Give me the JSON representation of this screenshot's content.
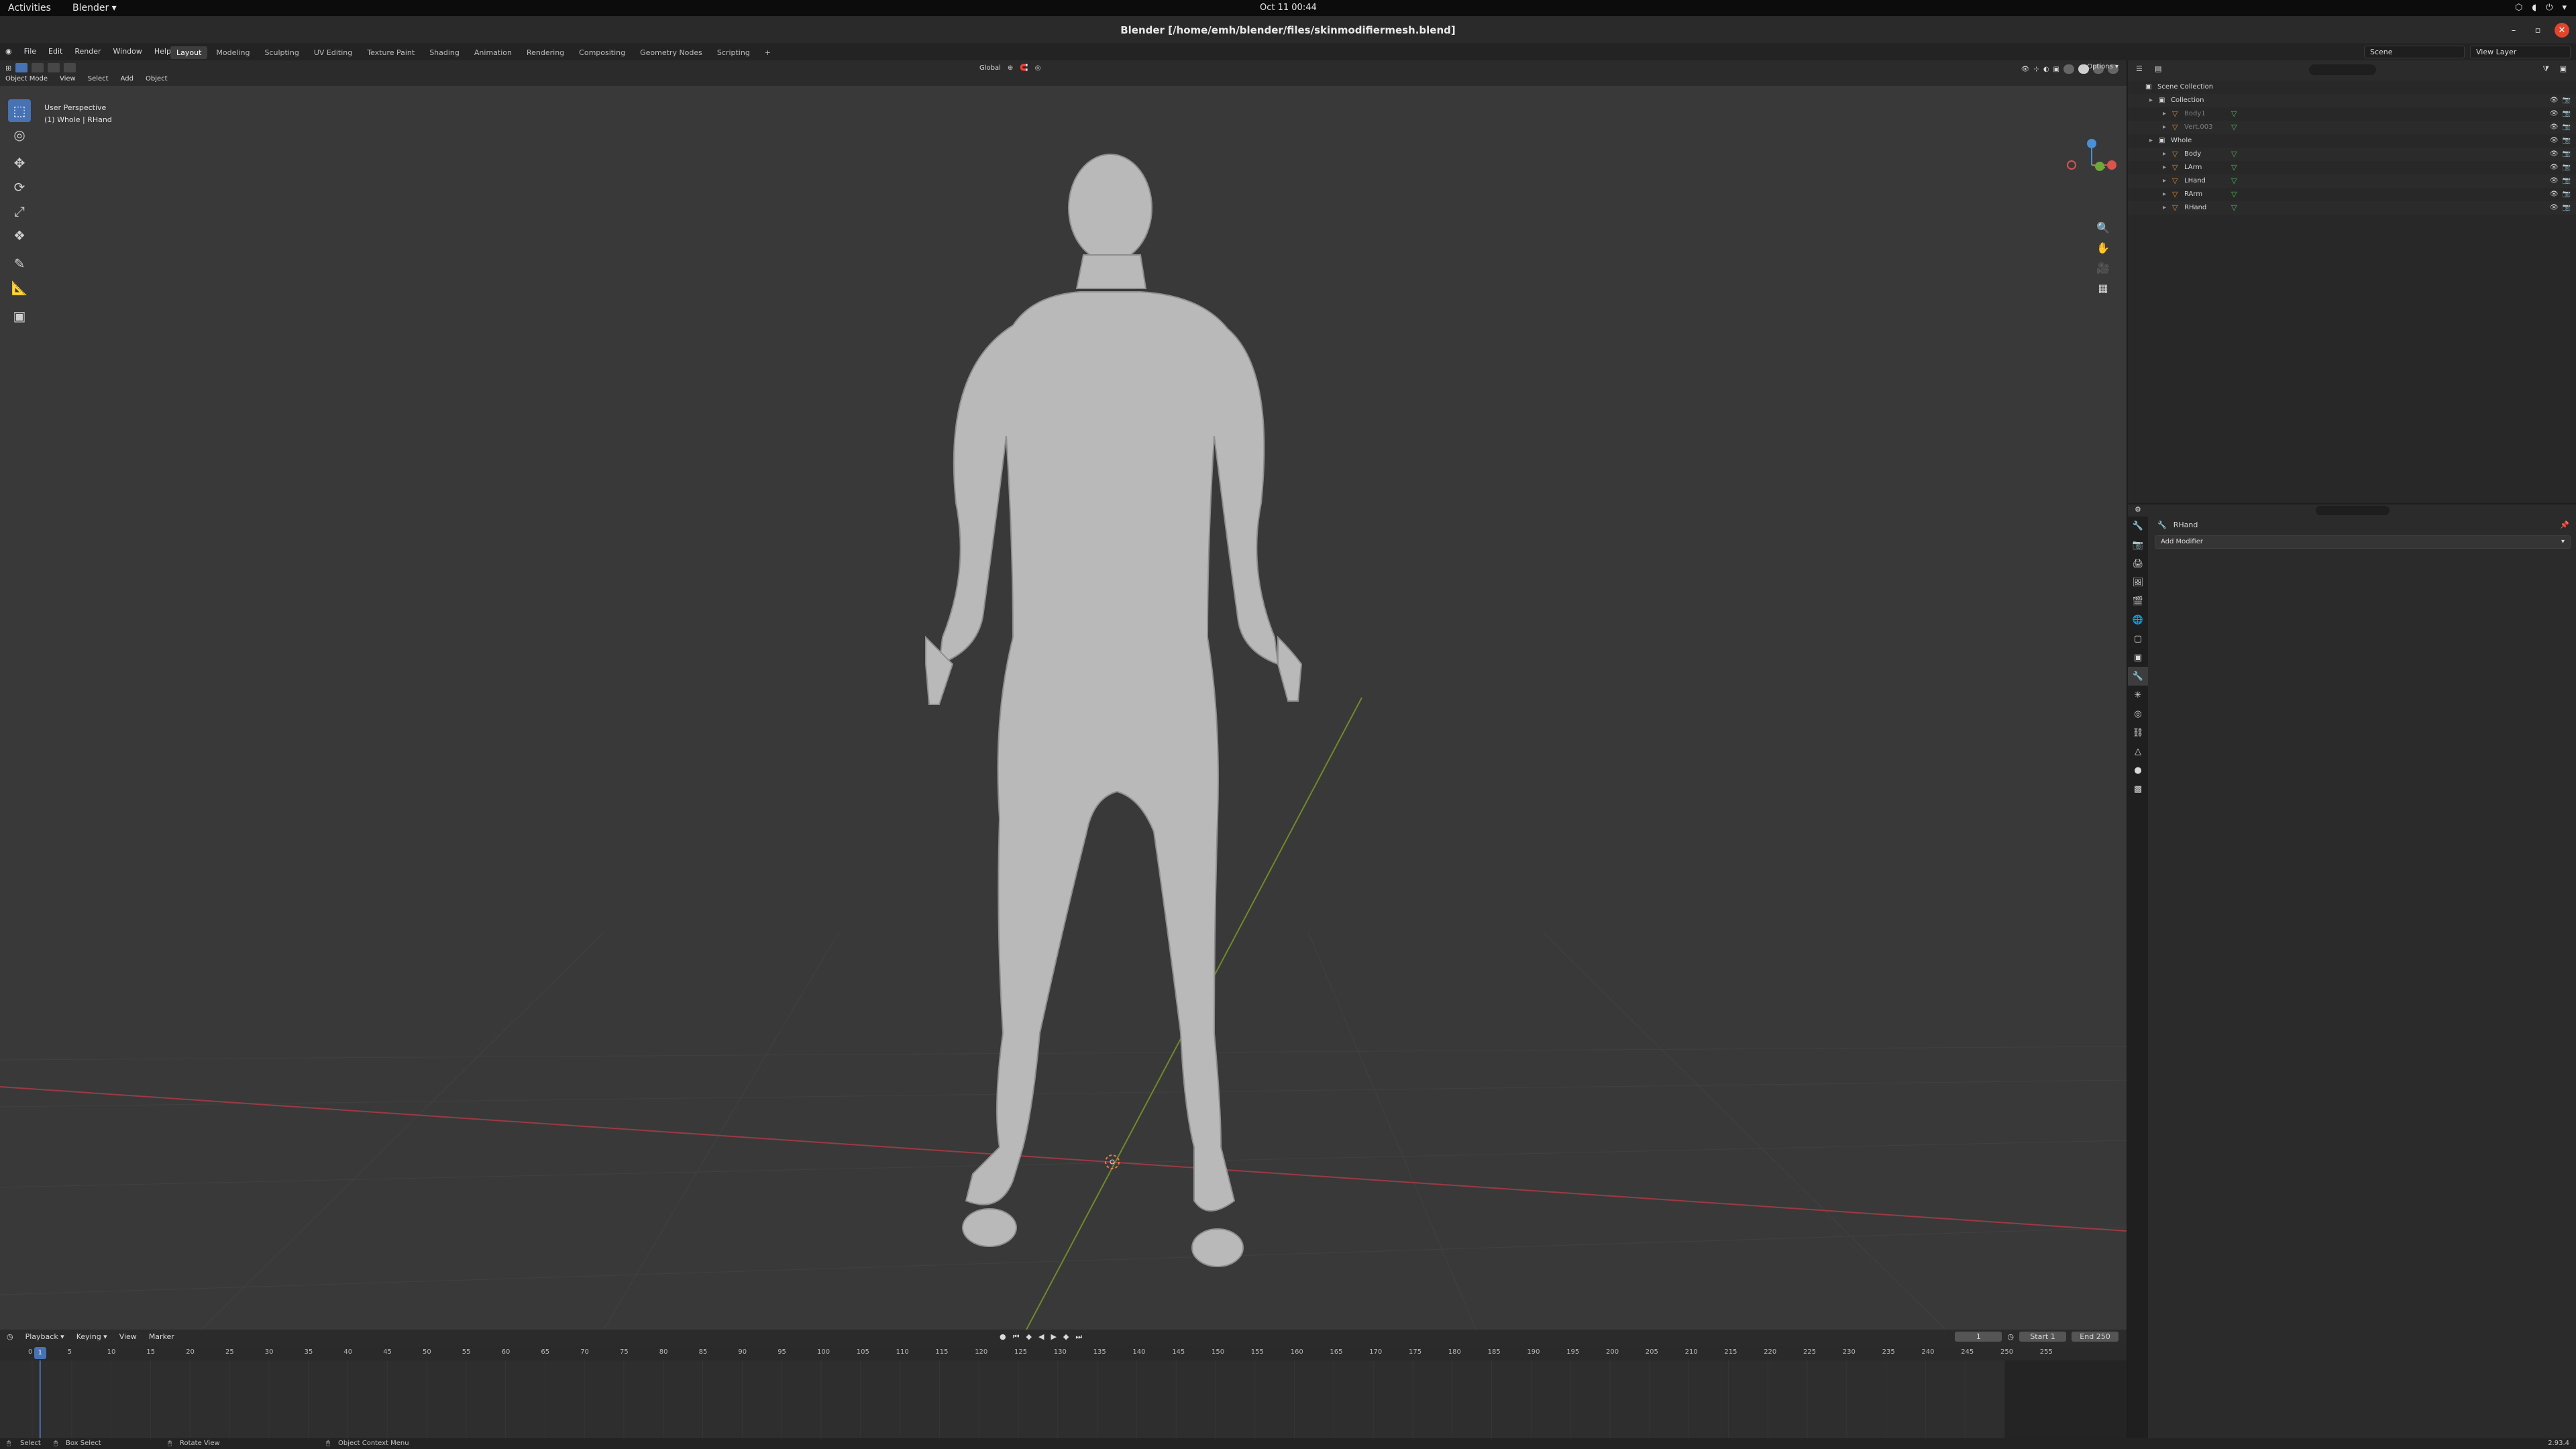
{
  "os_bar": {
    "activities": "Activities",
    "app_menu": "Blender ▾",
    "clock": "Oct 11  00:44"
  },
  "window": {
    "title": "Blender [/home/emh/blender/files/skinmodifiermesh.blend]"
  },
  "menu": [
    "File",
    "Edit",
    "Render",
    "Window",
    "Help"
  ],
  "workspace_tabs": [
    "Layout",
    "Modeling",
    "Sculpting",
    "UV Editing",
    "Texture Paint",
    "Shading",
    "Animation",
    "Rendering",
    "Compositing",
    "Geometry Nodes",
    "Scripting",
    "+"
  ],
  "scene": {
    "name": "Scene",
    "view_layer": "View Layer"
  },
  "viewport": {
    "mode": "Object Mode",
    "header_menus": [
      "View",
      "Select",
      "Add",
      "Object"
    ],
    "orientation": "Global",
    "options": "Options ▾",
    "perspective": "User Perspective",
    "context": "(1) Whole | RHand"
  },
  "timeline": {
    "menus": [
      "Playback ▾",
      "Keying ▾",
      "View",
      "Marker"
    ],
    "current_frame": "1",
    "start_label": "Start",
    "start": "1",
    "end_label": "End",
    "end": "250",
    "ticks": [
      "0",
      "5",
      "10",
      "15",
      "20",
      "25",
      "30",
      "35",
      "40",
      "45",
      "50",
      "55",
      "60",
      "65",
      "70",
      "75",
      "80",
      "85",
      "90",
      "95",
      "100",
      "105",
      "110",
      "115",
      "120",
      "125",
      "130",
      "135",
      "140",
      "145",
      "150",
      "155",
      "160",
      "165",
      "170",
      "175",
      "180",
      "185",
      "190",
      "195",
      "200",
      "205",
      "210",
      "215",
      "220",
      "225",
      "230",
      "235",
      "240",
      "245",
      "250",
      "255"
    ]
  },
  "outliner": {
    "rows": [
      {
        "label": "Scene Collection",
        "indent": 0,
        "kind": "scene"
      },
      {
        "label": "Collection",
        "indent": 1,
        "kind": "collection"
      },
      {
        "label": "Body1",
        "indent": 2,
        "kind": "mesh",
        "dim": true
      },
      {
        "label": "Vert.003",
        "indent": 2,
        "kind": "mesh",
        "dim": true
      },
      {
        "label": "Whole",
        "indent": 1,
        "kind": "collection"
      },
      {
        "label": "Body",
        "indent": 2,
        "kind": "mesh"
      },
      {
        "label": "LArm",
        "indent": 2,
        "kind": "mesh"
      },
      {
        "label": "LHand",
        "indent": 2,
        "kind": "mesh"
      },
      {
        "label": "RArm",
        "indent": 2,
        "kind": "mesh"
      },
      {
        "label": "RHand",
        "indent": 2,
        "kind": "mesh"
      }
    ]
  },
  "properties": {
    "object": "RHand",
    "add_modifier": "Add Modifier",
    "add_modifier_arrow": "▾"
  },
  "statusbar": {
    "select": "Select",
    "box_select": "Box Select",
    "rotate_view": "Rotate View",
    "context_menu": "Object Context Menu",
    "version": "2.93.4"
  }
}
